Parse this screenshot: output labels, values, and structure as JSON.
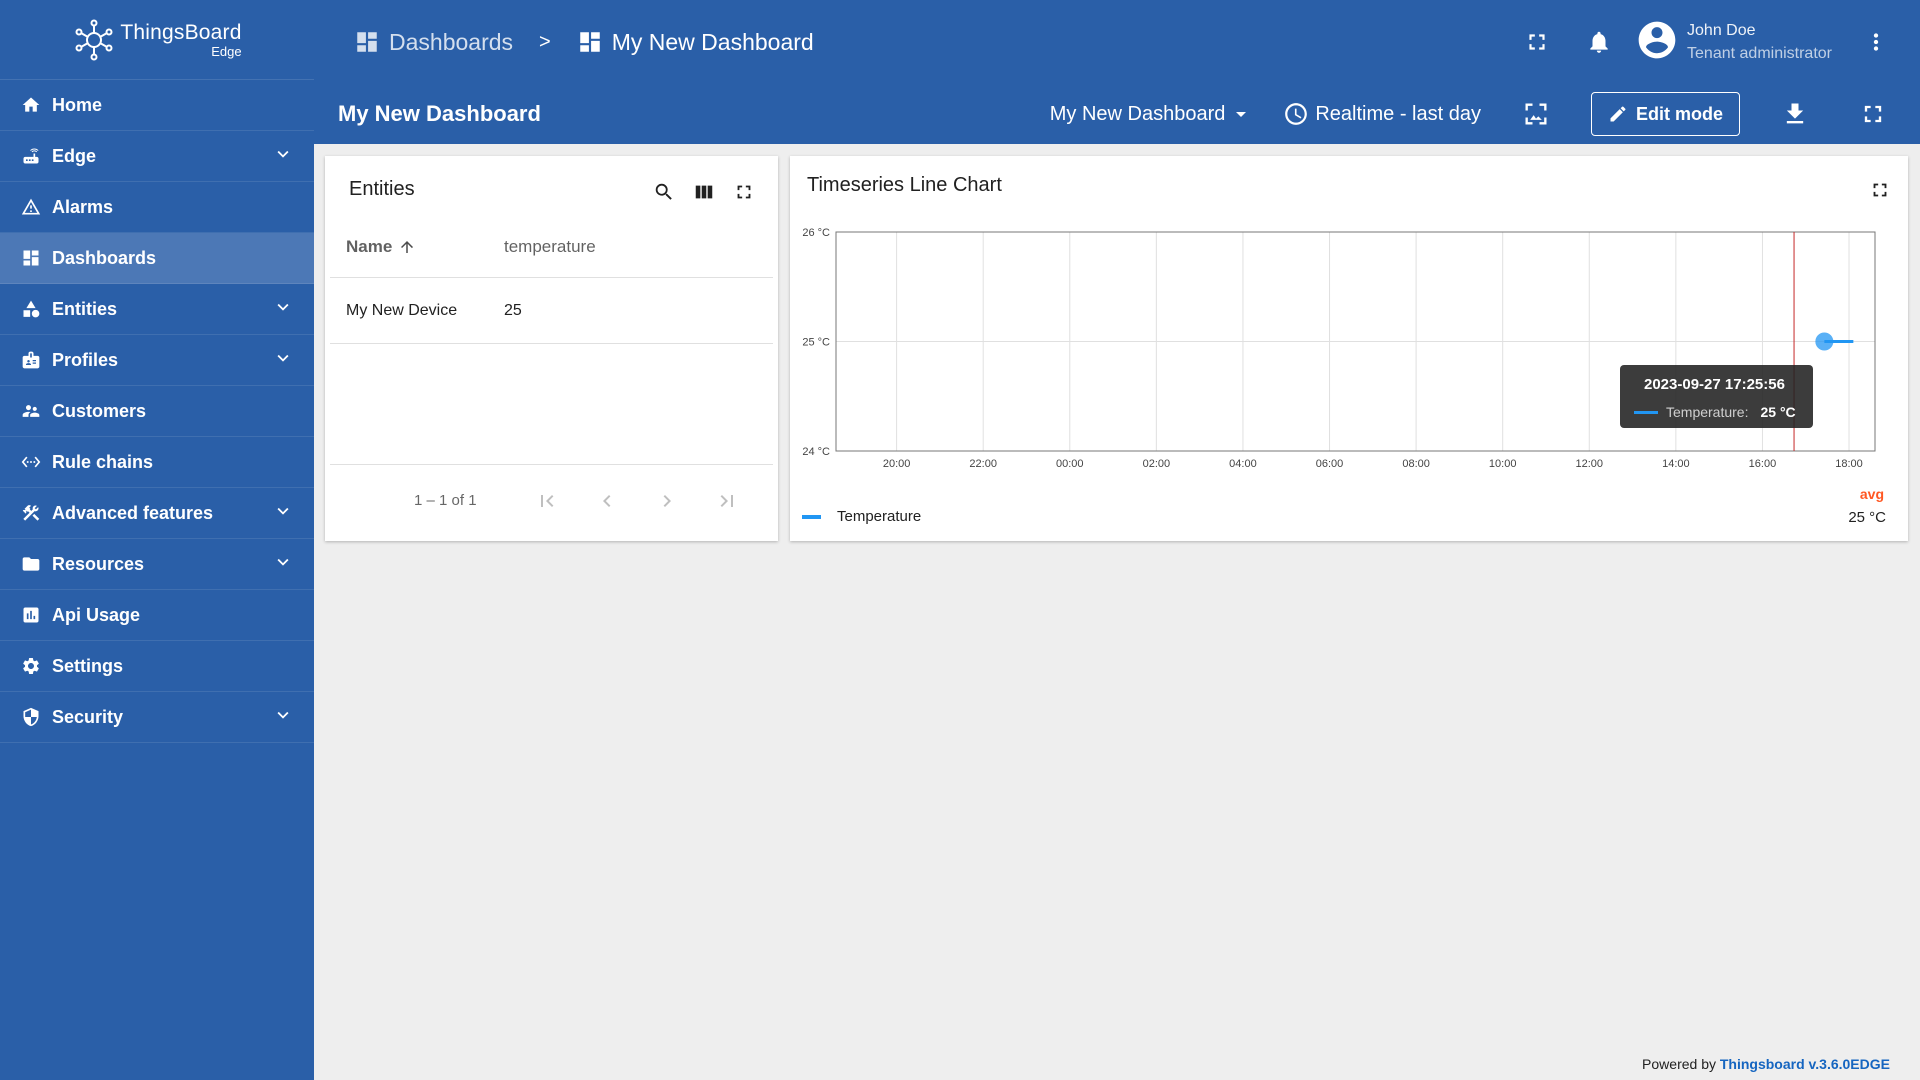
{
  "brand": {
    "name": "ThingsBoard",
    "sub": "Edge"
  },
  "sidebar": {
    "items": [
      {
        "label": "Home",
        "icon": "home-icon",
        "expandable": false,
        "active": false
      },
      {
        "label": "Edge",
        "icon": "router-icon",
        "expandable": true,
        "active": false
      },
      {
        "label": "Alarms",
        "icon": "warning-icon",
        "expandable": false,
        "active": false
      },
      {
        "label": "Dashboards",
        "icon": "dashboard-icon",
        "expandable": false,
        "active": true
      },
      {
        "label": "Entities",
        "icon": "category-icon",
        "expandable": true,
        "active": false
      },
      {
        "label": "Profiles",
        "icon": "badge-icon",
        "expandable": true,
        "active": false
      },
      {
        "label": "Customers",
        "icon": "supervisor-icon",
        "expandable": false,
        "active": false
      },
      {
        "label": "Rule chains",
        "icon": "settings-ethernet-icon",
        "expandable": false,
        "active": false
      },
      {
        "label": "Advanced features",
        "icon": "construction-icon",
        "expandable": true,
        "active": false
      },
      {
        "label": "Resources",
        "icon": "folder-icon",
        "expandable": true,
        "active": false
      },
      {
        "label": "Api Usage",
        "icon": "insert-chart-icon",
        "expandable": false,
        "active": false
      },
      {
        "label": "Settings",
        "icon": "gear-icon",
        "expandable": false,
        "active": false
      },
      {
        "label": "Security",
        "icon": "shield-icon",
        "expandable": true,
        "active": false
      }
    ]
  },
  "header": {
    "breadcrumb": [
      {
        "label": "Dashboards",
        "icon": "dashboard-icon"
      },
      {
        "label": "My New Dashboard",
        "icon": "dashboard-icon"
      }
    ],
    "separator": ">",
    "user": {
      "name": "John Doe",
      "role": "Tenant administrator"
    }
  },
  "dashboard": {
    "title": "My New Dashboard",
    "selected_dashboard": "My New Dashboard",
    "time_window": "Realtime - last day",
    "edit_label": "Edit mode"
  },
  "entities_widget": {
    "title": "Entities",
    "columns": [
      "Name",
      "temperature"
    ],
    "rows": [
      {
        "name": "My New Device",
        "temperature": "25"
      }
    ],
    "pagination": "1 – 1 of 1"
  },
  "chart_widget": {
    "title": "Timeseries Line Chart",
    "legend": {
      "series": "Temperature",
      "avg_label": "avg",
      "avg_value": "25 °C"
    },
    "tooltip": {
      "time": "2023-09-27 17:25:56",
      "label": "Temperature:",
      "value": "25 °C"
    }
  },
  "chart_data": {
    "type": "line",
    "title": "Timeseries Line Chart",
    "xlabel": "",
    "ylabel": "",
    "x_ticks": [
      "20:00",
      "22:00",
      "00:00",
      "02:00",
      "04:00",
      "06:00",
      "08:00",
      "10:00",
      "12:00",
      "14:00",
      "16:00",
      "18:00"
    ],
    "y_ticks": [
      "24 °C",
      "25 °C",
      "26 °C"
    ],
    "ylim": [
      24,
      26
    ],
    "x_range_hours": [
      18.6,
      42.6
    ],
    "grid": true,
    "legend_position": "bottom-left",
    "series": [
      {
        "name": "Temperature",
        "color": "#2196f3",
        "points": [
          {
            "x": 41.43,
            "y": 25
          },
          {
            "x": 42.1,
            "y": 25
          }
        ]
      }
    ],
    "cursor_x": 40.73,
    "cursor_color": "#c62828"
  },
  "footer": {
    "prefix": "Powered by ",
    "link": "Thingsboard v.3.6.0EDGE"
  }
}
